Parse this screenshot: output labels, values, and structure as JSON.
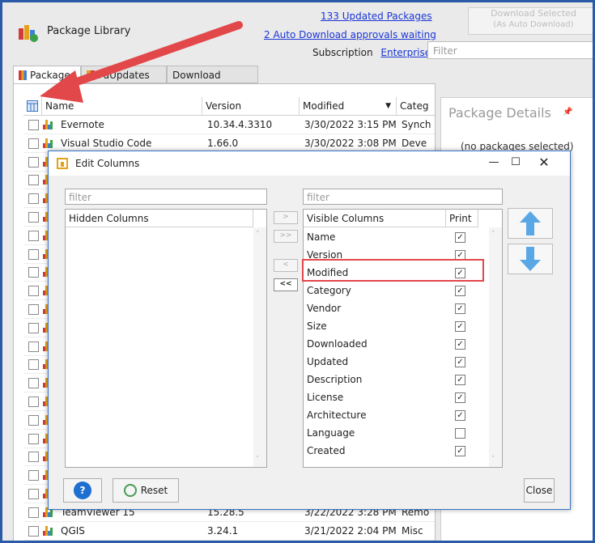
{
  "app": {
    "title": "Package Library"
  },
  "header": {
    "updated_link": "133 Updated Packages",
    "approvals_link": "2 Auto Download approvals waiting",
    "subscription_label": "Subscription",
    "subscription_link": "Enterprise",
    "download_selected": "Download Selected",
    "download_selected_sub": "(As Auto Download)",
    "filter_placeholder": "Filter"
  },
  "tabs": [
    {
      "label": "Packages"
    },
    {
      "label": "Updates",
      "partial_prefix": "Pa"
    },
    {
      "label": "Download History"
    }
  ],
  "grid": {
    "columns": [
      "Name",
      "Version",
      "Modified",
      "Categ"
    ],
    "rows": [
      {
        "name": "Evernote",
        "version": "10.34.4.3310",
        "modified": "3/30/2022 3:15 PM",
        "category": "Synch"
      },
      {
        "name": "Visual Studio Code",
        "version": "1.66.0",
        "modified": "3/30/2022 3:08 PM",
        "category": "Deve"
      }
    ],
    "bottom_rows": [
      {
        "name": "TeamViewer 15",
        "version": "15.28.5",
        "modified": "3/22/2022 3:28 PM",
        "category": "Remo"
      },
      {
        "name": "QGIS",
        "version": "3.24.1",
        "modified": "3/21/2022 2:04 PM",
        "category": "Misc"
      }
    ]
  },
  "details": {
    "title": "Package Details",
    "pin_icon": "pin-icon",
    "empty_text": "(no packages selected)"
  },
  "dialog": {
    "title": "Edit Columns",
    "hidden_filter_placeholder": "filter",
    "visible_filter_placeholder": "filter",
    "hidden_header": "Hidden Columns",
    "visible_header": "Visible Columns",
    "print_header": "Print",
    "move_buttons": [
      ">",
      ">>",
      "<",
      "<<"
    ],
    "visible_columns": [
      {
        "name": "Name",
        "print": true
      },
      {
        "name": "Version",
        "print": true
      },
      {
        "name": "Modified",
        "print": true
      },
      {
        "name": "Category",
        "print": true
      },
      {
        "name": "Vendor",
        "print": true
      },
      {
        "name": "Size",
        "print": true
      },
      {
        "name": "Downloaded",
        "print": true
      },
      {
        "name": "Updated",
        "print": true
      },
      {
        "name": "Description",
        "print": true
      },
      {
        "name": "License",
        "print": true
      },
      {
        "name": "Architecture",
        "print": true
      },
      {
        "name": "Language",
        "print": false
      },
      {
        "name": "Created",
        "print": true
      }
    ],
    "help_label": "?",
    "reset_label": "Reset",
    "close_label": "Close"
  },
  "colors": {
    "arrow": "#e2474a",
    "link": "#1a35d6",
    "accent_blue": "#3a74c4"
  }
}
